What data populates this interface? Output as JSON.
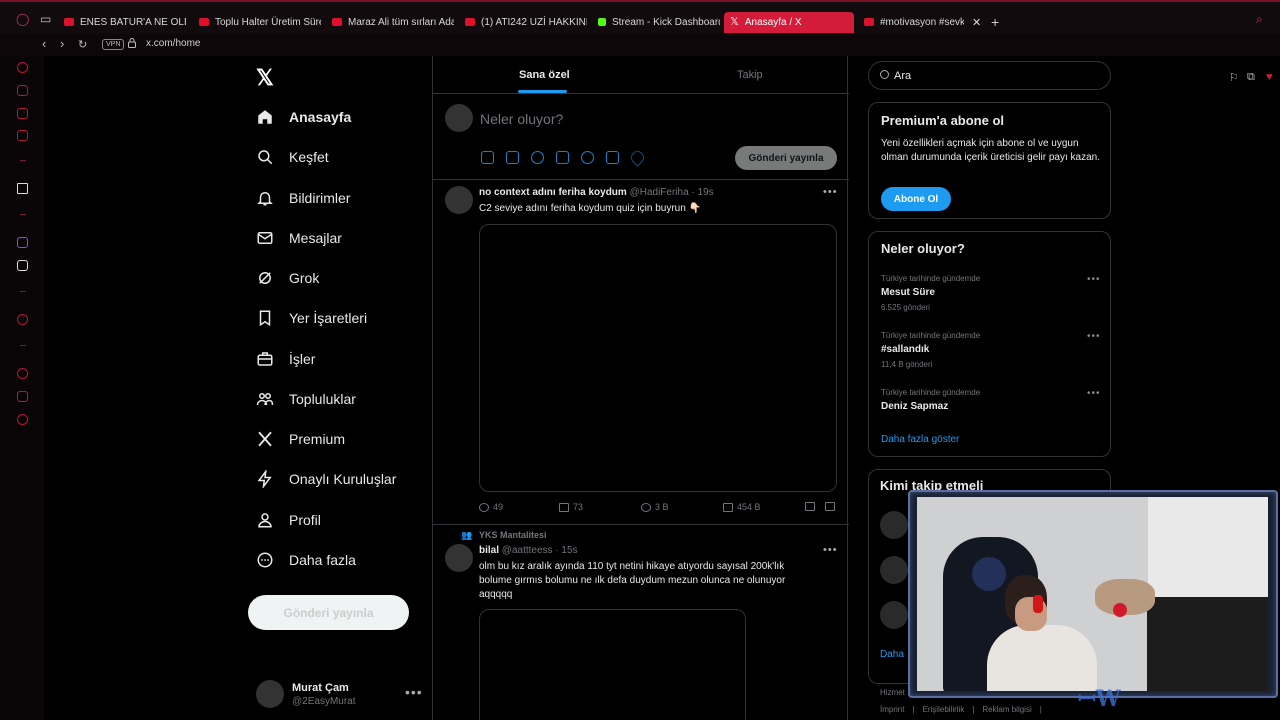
{
  "browser": {
    "tabs": [
      {
        "label": "ENES BATUR'A NE OLDU",
        "type": "youtube"
      },
      {
        "label": "Toplu Halter Üretim Süreç",
        "type": "youtube"
      },
      {
        "label": "Maraz Ali tüm sırları Adan",
        "type": "youtube"
      },
      {
        "label": "(1) ATI242 UZİ HAKKINDA",
        "type": "youtube"
      },
      {
        "label": "Stream - Kick Dashboard",
        "type": "kick"
      },
      {
        "label": "Anasayfa / X",
        "type": "x",
        "active": true
      },
      {
        "label": "#motivasyon #sevkiy",
        "type": "youtube"
      }
    ],
    "vpn_label": "VPN",
    "url": "x.com/home",
    "accent": "#d41c3a"
  },
  "nav": {
    "logo": "𝕏",
    "items": [
      {
        "label": "Anasayfa",
        "icon": "home-icon"
      },
      {
        "label": "Keşfet",
        "icon": "search-icon"
      },
      {
        "label": "Bildirimler",
        "icon": "bell-icon"
      },
      {
        "label": "Mesajlar",
        "icon": "mail-icon"
      },
      {
        "label": "Grok",
        "icon": "grok-icon"
      },
      {
        "label": "Yer İşaretleri",
        "icon": "bookmark-icon"
      },
      {
        "label": "İşler",
        "icon": "briefcase-icon"
      },
      {
        "label": "Topluluklar",
        "icon": "people-icon"
      },
      {
        "label": "Premium",
        "icon": "x-icon"
      },
      {
        "label": "Onaylı Kuruluşlar",
        "icon": "lightning-icon"
      },
      {
        "label": "Profil",
        "icon": "person-icon"
      },
      {
        "label": "Daha fazla",
        "icon": "more-circle-icon"
      }
    ],
    "post_button": "Gönderi yayınla",
    "user": {
      "name": "Murat Çam",
      "handle": "@2EasyMurat"
    }
  },
  "timeline": {
    "tabs": [
      "Sana özel",
      "Takip"
    ],
    "composer": {
      "placeholder": "Neler oluyor?",
      "submit": "Gönderi yayınla"
    },
    "tweets": [
      {
        "name": "no context adını feriha koydum",
        "handle": "@HadiFeriha · 19s",
        "text": "C2 seviye adını feriha koydum quiz için buyrun 👇🏻",
        "replies": "49",
        "retweets": "73",
        "likes": "3 B",
        "views": "454 B"
      },
      {
        "social_context": "YKS Mantalitesi",
        "name": "bilal",
        "handle": "@aattteess · 15s",
        "text": "olm bu kız aralık ayında 110 tyt netini hikaye atıyordu sayısal 200k'lık bolume gırmıs bolumu ne ılk defa duydum mezun olunca ne olunuyor aqqqqq"
      }
    ]
  },
  "right": {
    "search_placeholder": "Ara",
    "premium": {
      "title": "Premium'a abone ol",
      "text": "Yeni özellikleri açmak için abone ol ve uygun olman durumunda içerik üreticisi gelir payı kazan.",
      "button": "Abone Ol"
    },
    "trends": {
      "title": "Neler oluyor?",
      "items": [
        {
          "context": "Türkiye tarihinde gündemde",
          "name": "Mesut Süre",
          "count": "6.525 gönderi"
        },
        {
          "context": "Türkiye tarihinde gündemde",
          "name": "#sallandık",
          "count": "11,4 B gönderi"
        },
        {
          "context": "Türkiye tarihinde gündemde",
          "name": "Deniz Sapmaz",
          "count": ""
        }
      ],
      "more": "Daha fazla göster"
    },
    "follow": {
      "title": "Kimi takip etmeli",
      "more": "Daha"
    },
    "footer_top": "Hizmet",
    "footer": [
      "İmprint",
      "Erişilebilirlik",
      "Reklam bilgisi"
    ]
  }
}
